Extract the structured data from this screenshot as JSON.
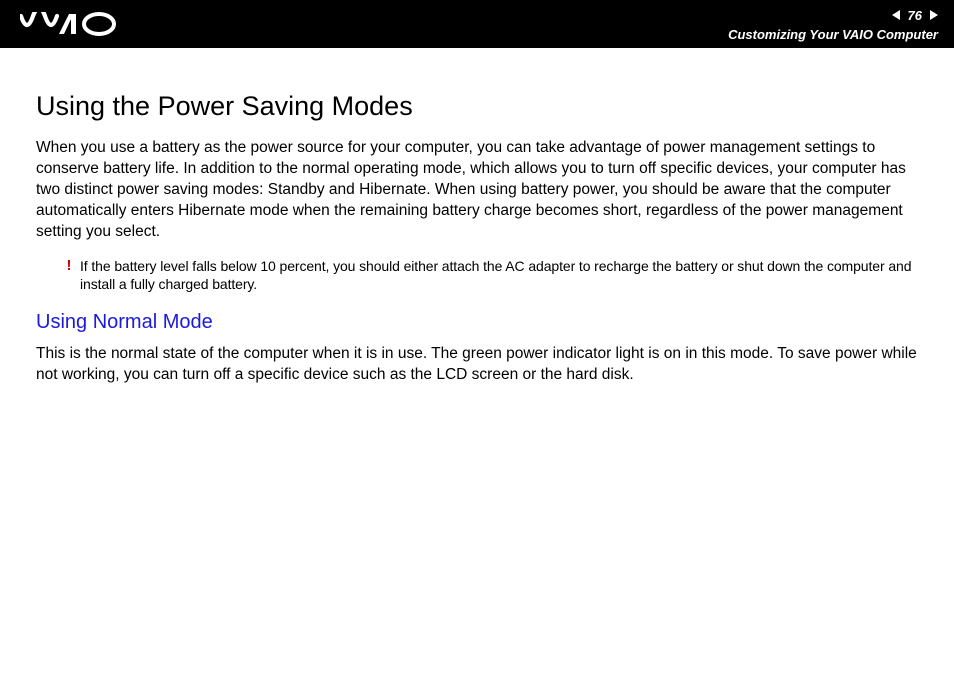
{
  "header": {
    "page_number": "76",
    "section_title": "Customizing Your VAIO Computer"
  },
  "content": {
    "heading": "Using the Power Saving Modes",
    "paragraph1": "When you use a battery as the power source for your computer, you can take advantage of power management settings to conserve battery life. In addition to the normal operating mode, which allows you to turn off specific devices, your computer has two distinct power saving modes: Standby and Hibernate. When using battery power, you should be aware that the computer automatically enters Hibernate mode when the remaining battery charge becomes short, regardless of the power management setting you select.",
    "caution_symbol": "!",
    "caution_text": "If the battery level falls below 10 percent, you should either attach the AC adapter to recharge the battery or shut down the computer and install a fully charged battery.",
    "subheading": "Using Normal Mode",
    "paragraph2": "This is the normal state of the computer when it is in use. The green power indicator light is on in this mode. To save power while not working, you can turn off a specific device such as the LCD screen or the hard disk."
  }
}
